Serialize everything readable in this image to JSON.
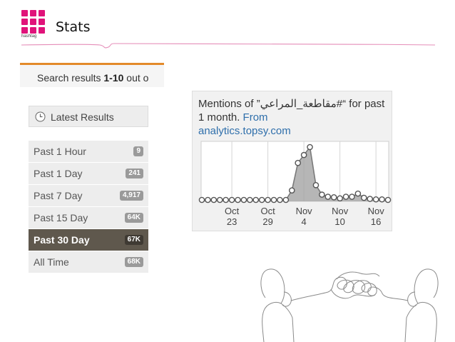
{
  "header": {
    "logo_text": "hashtag",
    "title": "Stats"
  },
  "search": {
    "prefix": "Search results ",
    "range": "1-10",
    "suffix": " out o"
  },
  "latest": {
    "label": "Latest Results",
    "icon": "clock-icon"
  },
  "time_ranges": [
    {
      "label": "Past 1 Hour",
      "count": "9",
      "active": false
    },
    {
      "label": "Past 1 Day",
      "count": "241",
      "active": false
    },
    {
      "label": "Past 7 Day",
      "count": "4,917",
      "active": false
    },
    {
      "label": "Past 15 Day",
      "count": "64K",
      "active": false
    },
    {
      "label": "Past 30 Day",
      "count": "67K",
      "active": true
    },
    {
      "label": "All Time",
      "count": "68K",
      "active": false
    }
  ],
  "mentions": {
    "prefix": "Mentions of ",
    "query": "“#مقاطعة_المراعي”",
    "suffix": " for past 1 month.",
    "link_lead": "From",
    "link": "analytics.topsy.com"
  },
  "chart_data": {
    "type": "area",
    "x_tick_labels": [
      [
        "Oct",
        "23"
      ],
      [
        "Oct",
        "29"
      ],
      [
        "Nov",
        "4"
      ],
      [
        "Nov",
        "10"
      ],
      [
        "Nov",
        "16"
      ]
    ],
    "values": [
      0,
      0,
      0,
      0,
      0,
      0,
      0,
      0,
      0,
      0,
      0,
      0,
      0,
      0,
      0,
      0.18,
      0.7,
      0.85,
      1.0,
      0.28,
      0.1,
      0.06,
      0.05,
      0.03,
      0.06,
      0.06,
      0.12,
      0.04,
      0.02,
      0.01,
      0.01,
      0
    ],
    "ylabel": "",
    "grid": true,
    "colors": {
      "fill": "#9e9e9e",
      "line": "#7a7a7a",
      "marker": "#ffffff"
    }
  },
  "colors": {
    "brand": "#e0137a",
    "accent": "#e38a2a",
    "active_range": "#5f584d",
    "link": "#2f6fab"
  }
}
